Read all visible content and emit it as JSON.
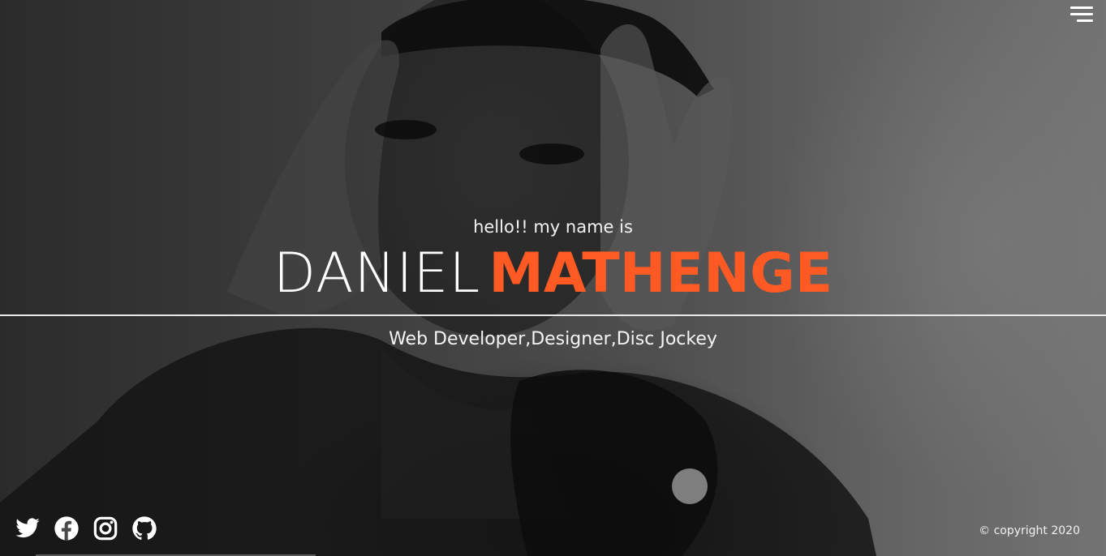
{
  "header": {
    "menu_icon": "hamburger-menu-icon"
  },
  "hero": {
    "intro": "hello!! my name is",
    "first_name": "DANIEL",
    "last_name": "MATHENGE",
    "roles": "Web Developer,Designer,Disc Jockey"
  },
  "social": [
    {
      "icon": "twitter-icon"
    },
    {
      "icon": "facebook-icon"
    },
    {
      "icon": "instagram-icon"
    },
    {
      "icon": "github-icon"
    }
  ],
  "footer": {
    "copyright": "© copyright 2020"
  },
  "colors": {
    "accent": "#ff5a24",
    "text": "#ffffff"
  }
}
